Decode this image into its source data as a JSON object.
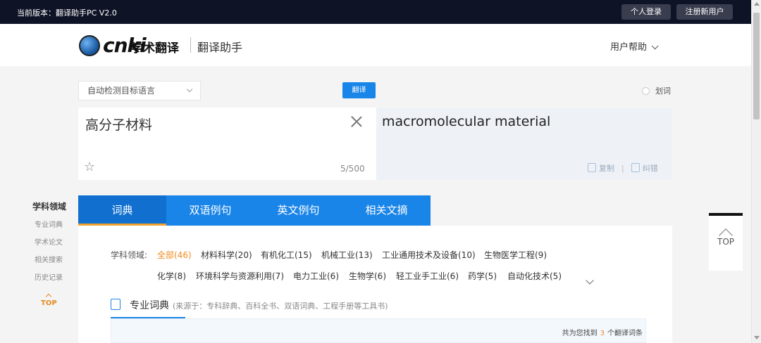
{
  "topbar": {
    "version": "当前版本：翻译助手PC V2.0",
    "login_label": "个人登录",
    "register_label": "注册新用户"
  },
  "header": {
    "logo_mark": "cnki",
    "logo_cn": "学术翻译",
    "subtitle": "翻译助手",
    "help_label": "用户帮助"
  },
  "translator": {
    "source_lang": "自动检测目标语言",
    "translate_label": "翻译",
    "word_pick_label": "划词",
    "source_text": "高分子材料",
    "char_count": "5/500",
    "target_text": "macromolecular material",
    "copy_label": "复制",
    "correct_label": "纠错"
  },
  "sidebar": {
    "heading": "学科领域",
    "items": [
      "专业词典",
      "学术论文",
      "相关搜索",
      "历史记录"
    ],
    "top_label": "TOP"
  },
  "tabs": [
    {
      "label": "词典",
      "active": true
    },
    {
      "label": "双语例句",
      "active": false
    },
    {
      "label": "英文例句",
      "active": false
    },
    {
      "label": "相关文摘",
      "active": false
    }
  ],
  "fields": {
    "label": "学科领域:",
    "row1": [
      "全部(46)",
      "材料科学(20)",
      "有机化工(15)",
      "机械工业(13)",
      "工业通用技术及设备(10)",
      "生物医学工程(9)"
    ],
    "row2": [
      "化学(8)",
      "环境科学与资源利用(7)",
      "电力工业(6)",
      "生物学(6)",
      "轻工业手工业(6)",
      "药学(5)",
      "自动化技术(5)"
    ]
  },
  "dictionary": {
    "title": "专业词典",
    "source_note": "(来源于：专科辞典、百科全书、双语词典、工程手册等工具书)",
    "count_prefix": "共为您找到",
    "count": "3",
    "count_suffix": "个翻译词条"
  },
  "float_top": {
    "label": "TOP"
  },
  "colors": {
    "accent": "#1a85e8",
    "highlight": "#ef8a1c",
    "topbar": "#0f1326"
  }
}
